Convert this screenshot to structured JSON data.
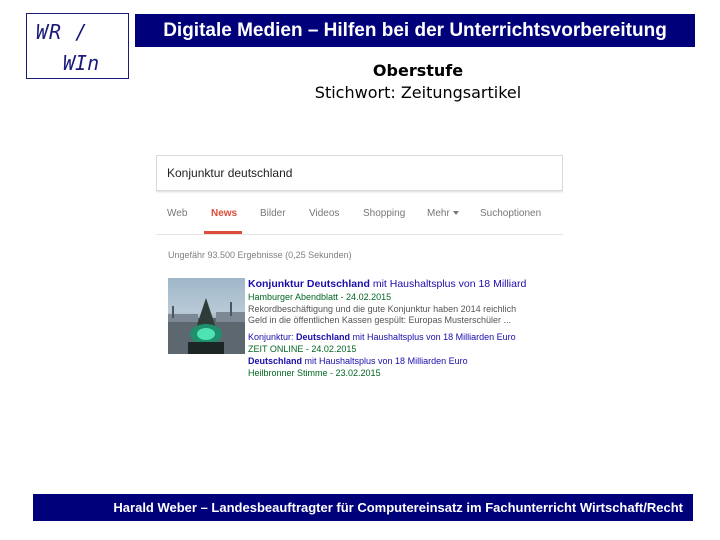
{
  "logo": {
    "line1": "WR /",
    "line2": "WIn"
  },
  "header": {
    "title": "Digitale Medien – Hilfen bei der Unterrichtsvorbereitung"
  },
  "subtitle": {
    "level": "Oberstufe",
    "keyword": "Stichwort: Zeitungsartikel"
  },
  "search": {
    "query": "Konjunktur deutschland",
    "tabs": [
      "Web",
      "News",
      "Bilder",
      "Videos",
      "Shopping",
      "Mehr",
      "Suchoptionen"
    ],
    "active_tab": "News",
    "stats": "Ungefähr 93.500 Ergebnisse (0,25 Sekunden)",
    "results": {
      "r1_title_bold": "Konjunktur Deutschland",
      "r1_title_rest": " mit Haushaltsplus von 18 Milliard",
      "r1_source": "Hamburger Abendblatt - 24.02.2015",
      "r1_snip1": "Rekordbeschäftigung und die gute Konjunktur haben 2014 reichlich",
      "r1_snip2": "Geld in die öffentlichen Kassen gespült: Europas Musterschüler ...",
      "r2_title_pre": "Konjunktur: ",
      "r2_title_bold": "Deutschland",
      "r2_title_rest": " mit Haushaltsplus von 18 Milliarden Euro",
      "r2_source": "ZEIT ONLINE - 24.02.2015",
      "r3_title_bold": "Deutschland",
      "r3_title_rest": " mit Haushaltsplus von 18 Milliarden Euro",
      "r3_source": "Heilbronner Stimme - 23.02.2015"
    },
    "colors": {
      "active_tab": "#dd4b39",
      "link": "#1a0dab",
      "source": "#006621"
    }
  },
  "footer": {
    "text": "Harald Weber – Landesbeauftragter für Computereinsatz im Fachunterricht Wirtschaft/Recht"
  },
  "colors": {
    "bar": "#00007a"
  }
}
